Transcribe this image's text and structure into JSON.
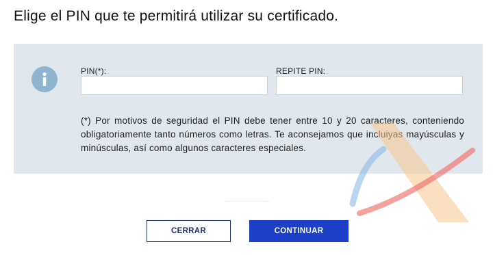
{
  "title": "Elige el PIN que te permitirá utilizar su certificado.",
  "panel": {
    "icon": "info-icon",
    "pin_label": "PIN(*):",
    "pin_value": "",
    "repite_label": "REPITE PIN:",
    "repite_value": "",
    "note": "(*) Por motivos de seguridad el PIN debe tener entre 10 y 20 caracteres, conteniendo obligatoriamente tanto números como letras. Te aconsejamos que incluiyas mayúsculas y minúsculas, así como algunos caracteres especiales."
  },
  "buttons": {
    "cerrar": "CERRAR",
    "continuar": "CONTINUAR"
  },
  "colors": {
    "panel_bg": "#e1e8ed",
    "icon_bg": "#8fb4cf",
    "primary": "#1e40c8",
    "outline": "#1f2d6b"
  }
}
